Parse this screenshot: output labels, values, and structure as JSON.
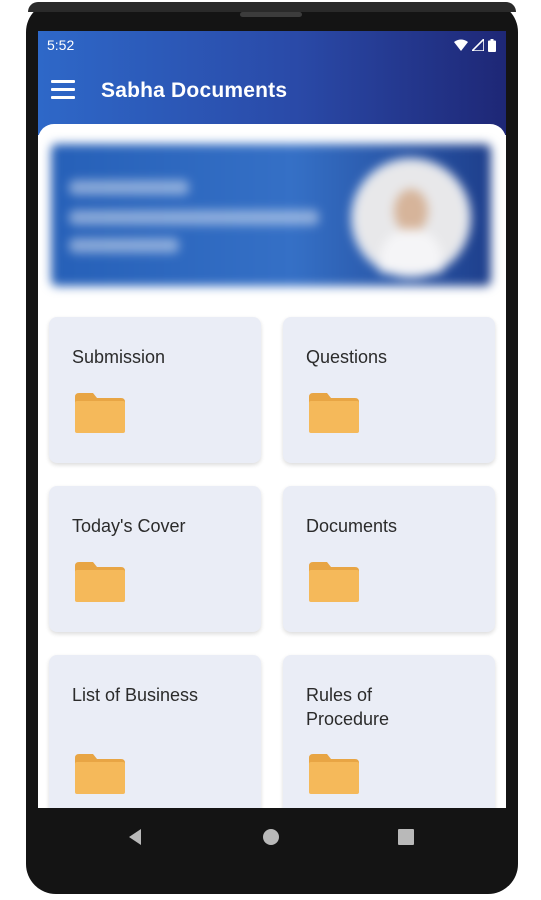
{
  "status_bar": {
    "time": "5:52",
    "icons": [
      "wifi-icon",
      "signal-icon",
      "battery-icon"
    ]
  },
  "app_bar": {
    "title": "Sabha Documents",
    "menu_icon": "hamburger-menu-icon"
  },
  "banner": {
    "description_visible": false
  },
  "cards": [
    {
      "label": "Submission",
      "icon": "folder-icon"
    },
    {
      "label": "Questions",
      "icon": "folder-icon"
    },
    {
      "label": "Today's Cover",
      "icon": "folder-icon"
    },
    {
      "label": "Documents",
      "icon": "folder-icon"
    },
    {
      "label": "List of Business",
      "icon": "folder-icon"
    },
    {
      "label": "Rules of Procedure",
      "icon": "folder-icon"
    }
  ],
  "nav_bar": {
    "buttons": [
      "back-icon",
      "home-icon",
      "recents-icon"
    ]
  },
  "colors": {
    "header_start": "#2e68c8",
    "header_end": "#1e2776",
    "card_background": "#eaedf6",
    "folder": "#f5b95a",
    "folder_tab": "#e8a544"
  }
}
